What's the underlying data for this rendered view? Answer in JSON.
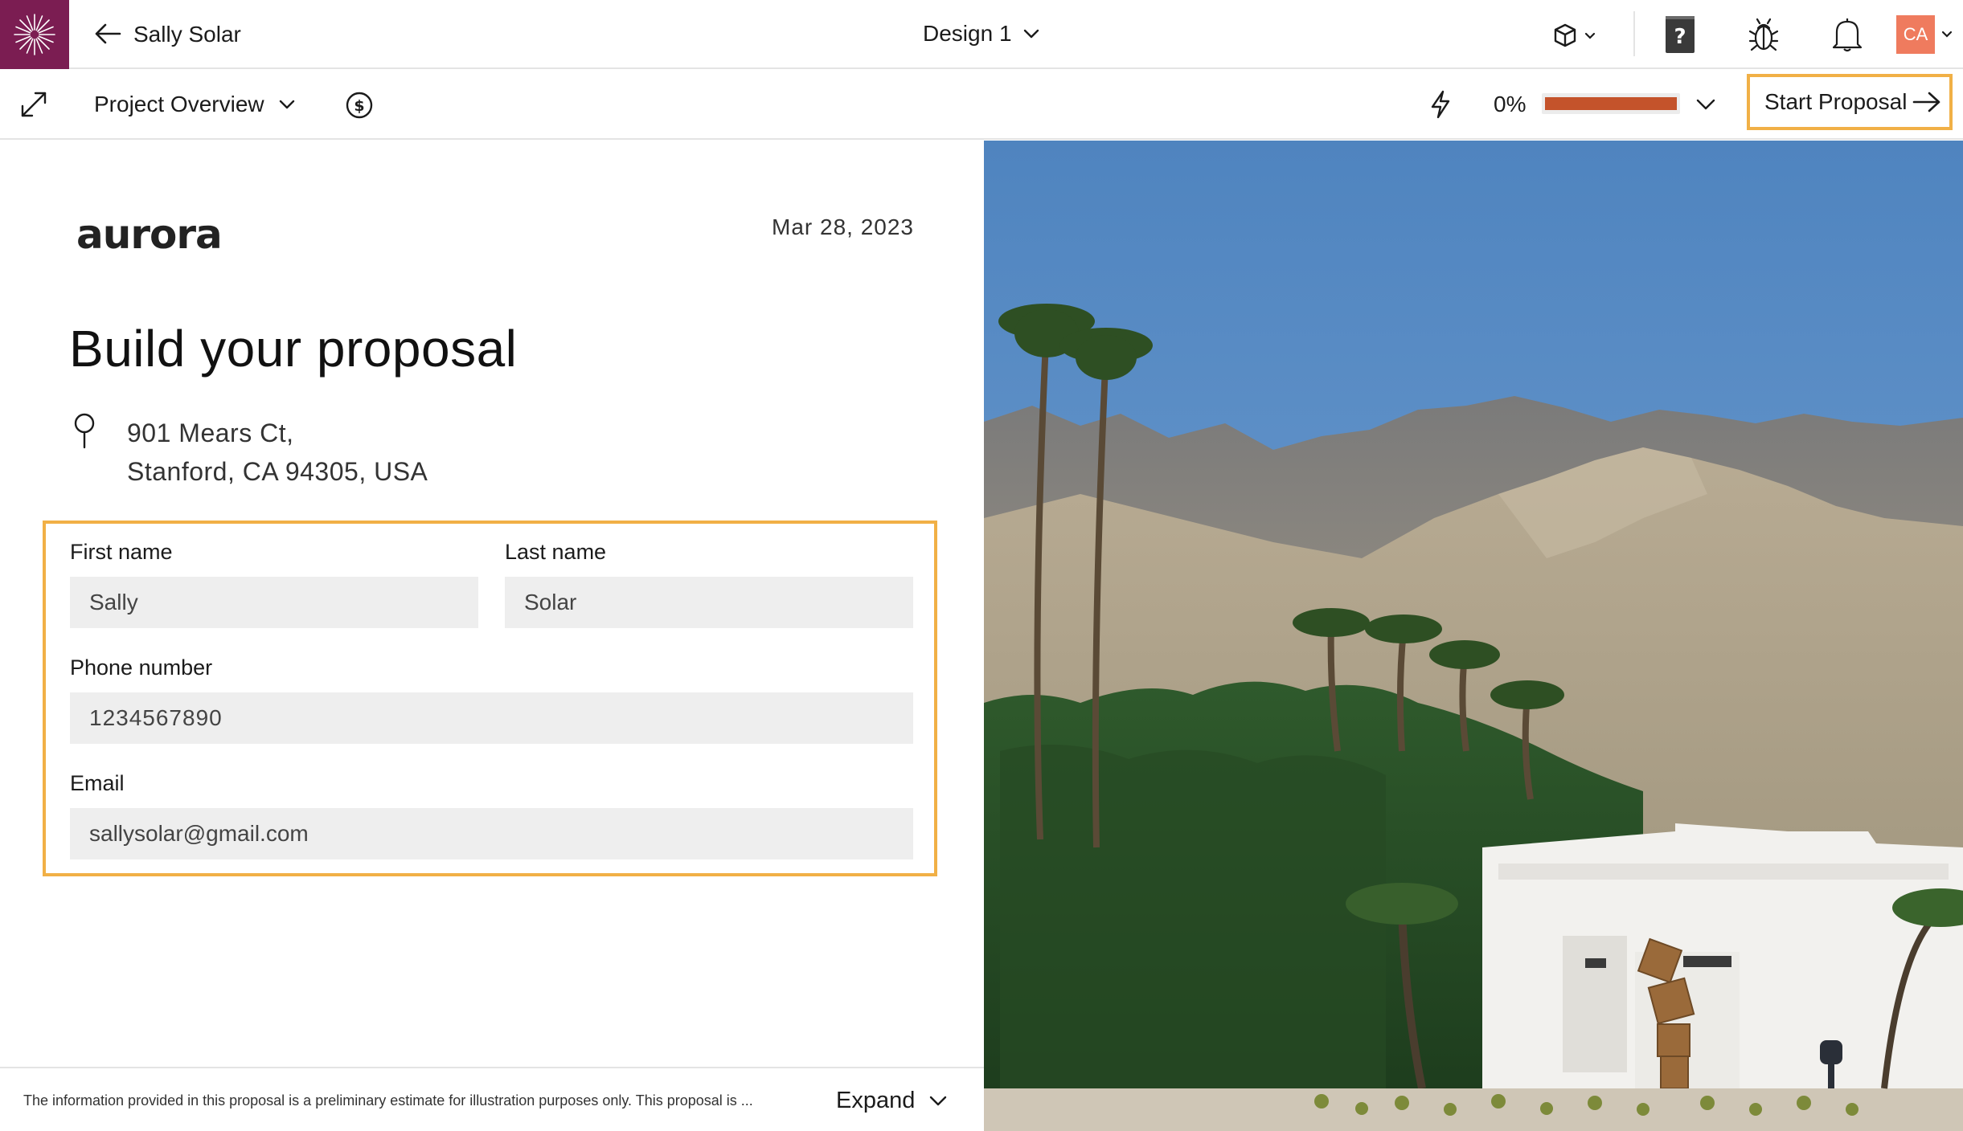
{
  "header": {
    "project_name": "Sally Solar",
    "design_label": "Design 1",
    "avatar_initials": "CA",
    "icons": [
      "back-arrow-icon",
      "cube-icon",
      "help-book-icon",
      "bug-icon",
      "bell-icon"
    ]
  },
  "toolbar": {
    "overview_label": "Project Overview",
    "progress_text": "0%",
    "progress_fraction": 1.0,
    "progress_color": "#c4532b",
    "start_label": "Start Proposal",
    "highlight_color": "#f1b046"
  },
  "proposal": {
    "logo_text": "aurora",
    "date": "Mar 28, 2023",
    "title": "Build your proposal",
    "address_line1": "901 Mears Ct,",
    "address_line2": "Stanford, CA 94305, USA"
  },
  "form": {
    "first_name_label": "First name",
    "first_name_value": "Sally",
    "last_name_label": "Last name",
    "last_name_value": "Solar",
    "phone_label": "Phone number",
    "phone_value": "1234567890",
    "email_label": "Email",
    "email_value": "sallysolar@gmail.com"
  },
  "footer": {
    "disclaimer": "The information provided in this proposal is a preliminary estimate for illustration purposes only. This proposal is ...",
    "expand_label": "Expand"
  },
  "colors": {
    "brand": "#7b1d52",
    "avatar": "#ef7b5e"
  }
}
